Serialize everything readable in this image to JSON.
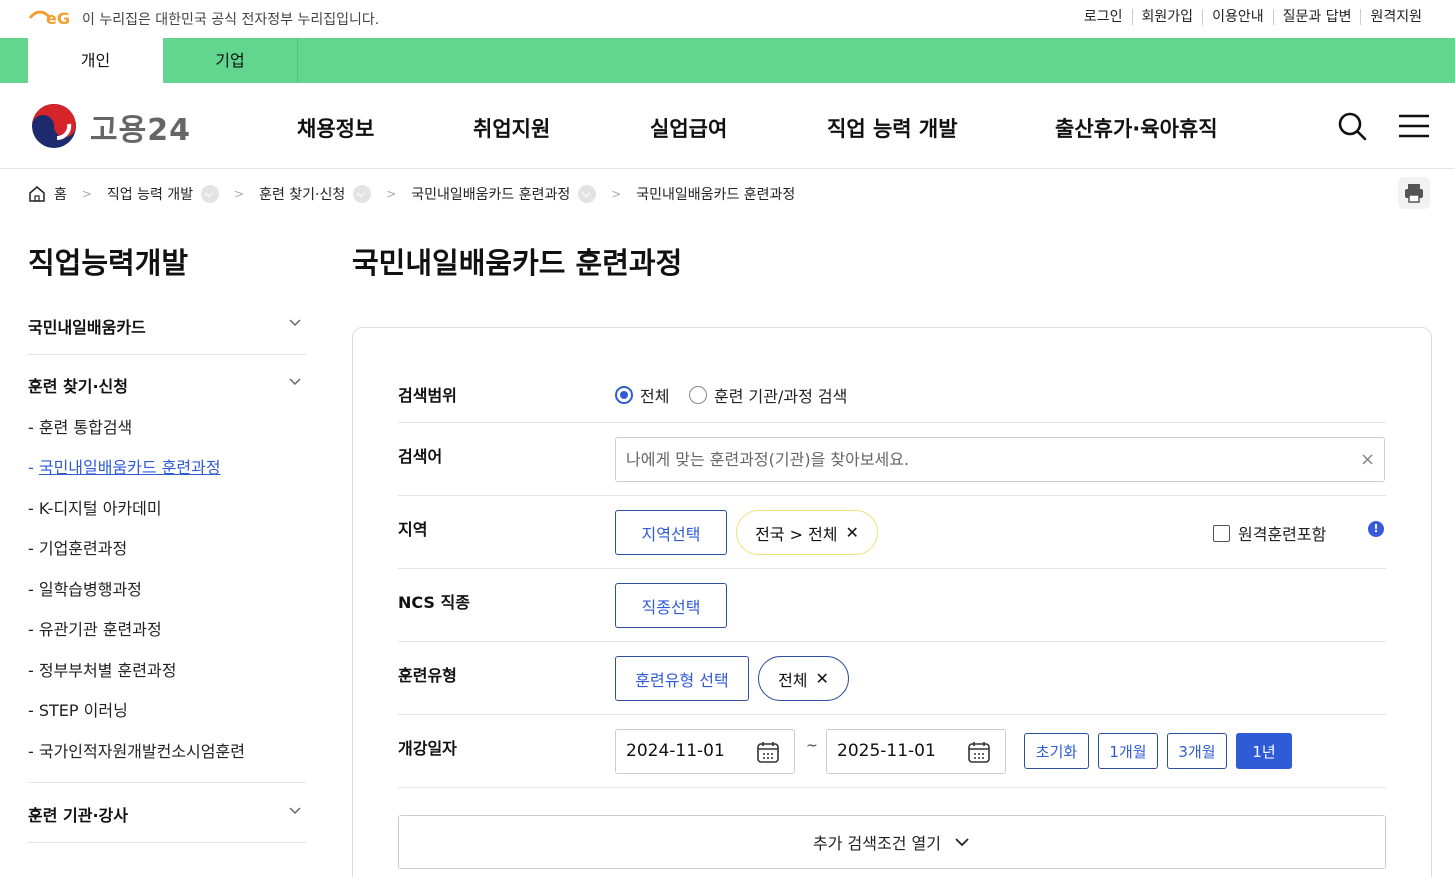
{
  "notice": {
    "text": "이 누리집은 대한민국 공식 전자정부 누리집입니다.",
    "util_links": [
      "로그인",
      "회원가입",
      "이용안내",
      "질문과 답변",
      "원격지원"
    ]
  },
  "tabs": {
    "personal": "개인",
    "business": "기업"
  },
  "header": {
    "logo_text": "고용24",
    "gnb": [
      "채용정보",
      "취업지원",
      "실업급여",
      "직업 능력 개발",
      "출산휴가·육아휴직"
    ]
  },
  "breadcrumb": {
    "home": "홈",
    "items": [
      "직업 능력 개발",
      "훈련 찾기·신청",
      "국민내일배움카드 훈련과정",
      "국민내일배움카드 훈련과정"
    ]
  },
  "lnb": {
    "title": "직업능력개발",
    "groups": [
      "국민내일배움카드",
      "훈련 찾기·신청",
      "훈련 기관·강사"
    ],
    "sub_items": [
      "훈련 통합검색",
      "국민내일배움카드 훈련과정",
      "K-디지털 아카데미",
      "기업훈련과정",
      "일학습병행과정",
      "유관기관 훈련과정",
      "정부부처별 훈련과정",
      "STEP 이러닝",
      "국가인적자원개발컨소시엄훈련"
    ],
    "active_index": 1
  },
  "content": {
    "title": "국민내일배움카드 훈련과정",
    "labels": {
      "scope": "검색범위",
      "keyword": "검색어",
      "region": "지역",
      "ncs": "NCS 직종",
      "type": "훈련유형",
      "date": "개강일자"
    },
    "scope_options": [
      "전체",
      "훈련 기관/과정 검색"
    ],
    "scope_selected": "전체",
    "keyword_placeholder": "나에게 맞는 훈련과정(기관)을 찾아보세요.",
    "keyword_value": "",
    "region_button": "지역선택",
    "region_chip": "전국 > 전체",
    "remote_checkbox": "원격훈련포함",
    "ncs_button": "직종선택",
    "type_button": "훈련유형 선택",
    "type_chip": "전체",
    "date_from": "2024-11-01",
    "date_to": "2025-11-01",
    "date_separator": "~",
    "period_buttons": [
      "초기화",
      "1개월",
      "3개월",
      "1년"
    ],
    "period_selected": "1년",
    "more_button": "추가 검색조건 열기"
  },
  "colors": {
    "green_bar": "#62d58f",
    "accent_blue": "#2f5bd6",
    "chip_border_yellow": "#f1e27a"
  }
}
